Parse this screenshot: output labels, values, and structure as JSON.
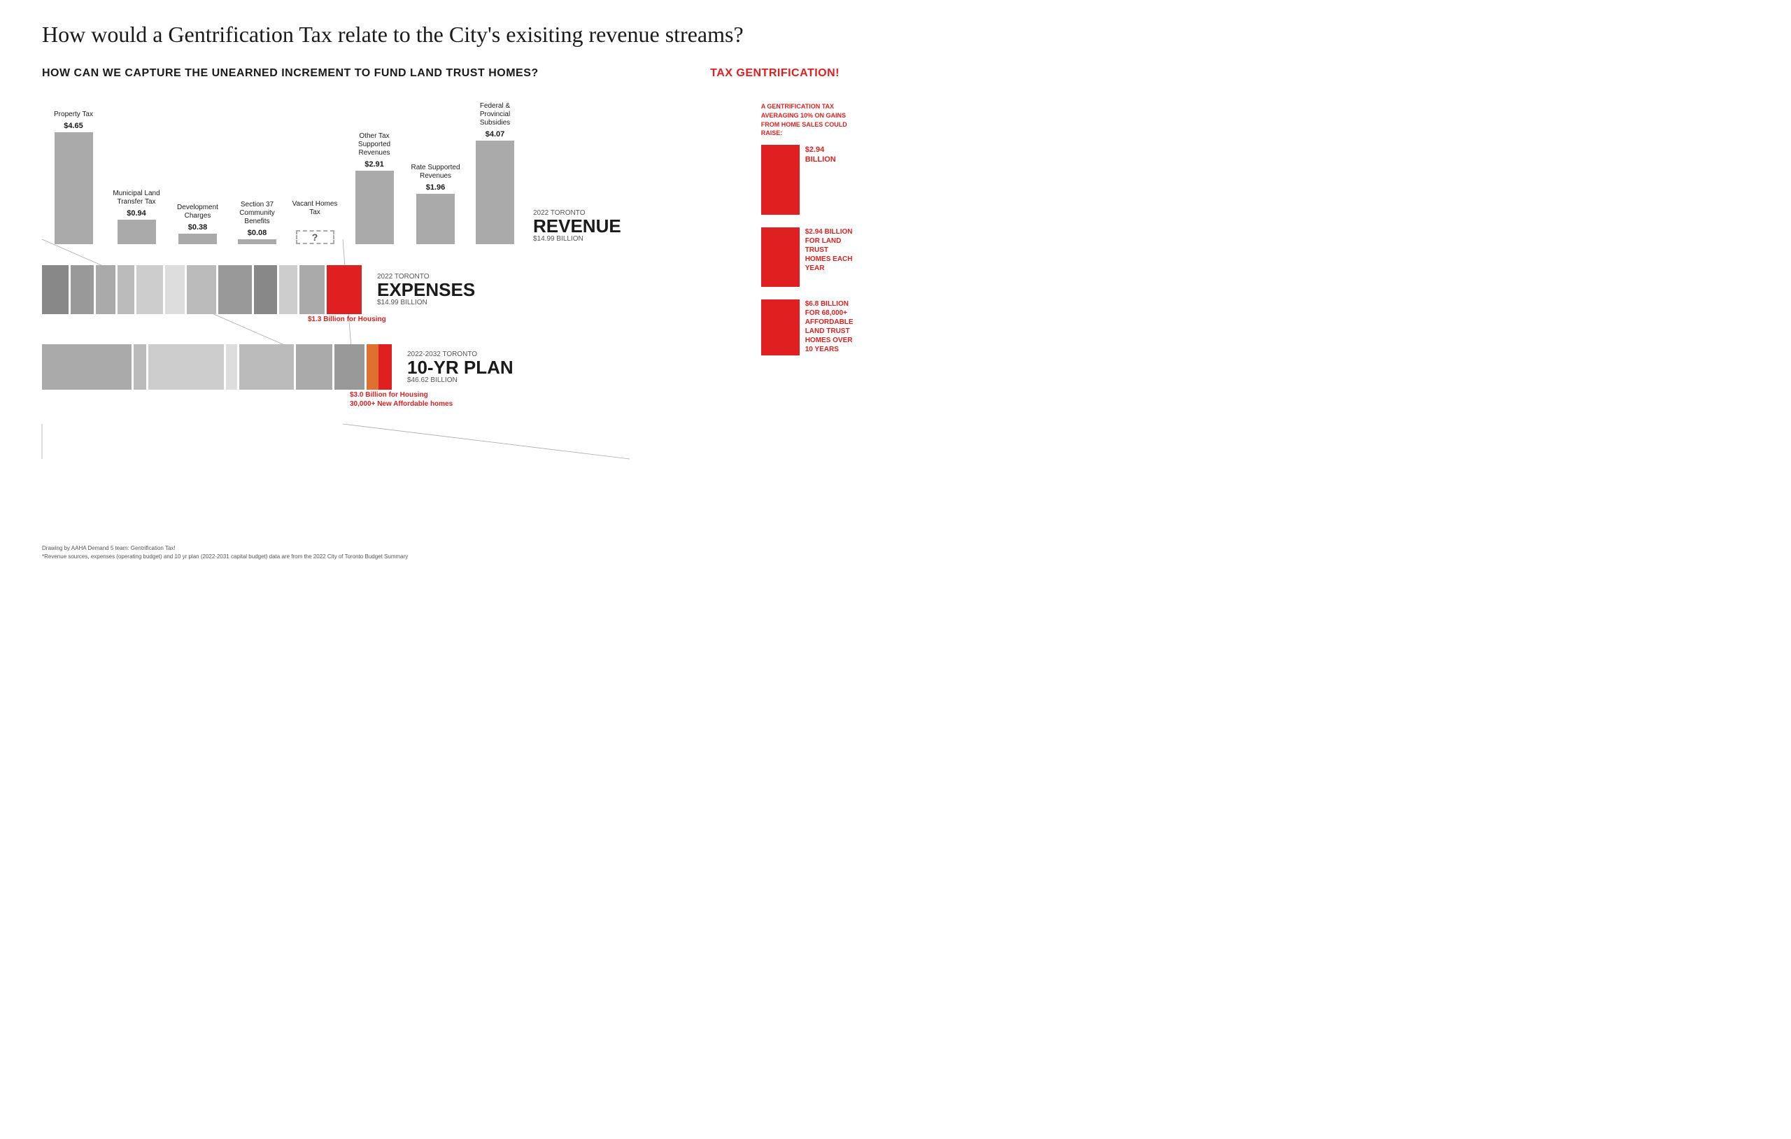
{
  "page": {
    "main_title": "How would a Gentrification Tax relate to the City's exisiting revenue streams?",
    "subtitle": "HOW CAN WE CAPTURE THE UNEARNED INCREMENT TO FUND LAND TRUST HOMES?",
    "tax_title": "TAX GENTRIFICATION!",
    "tax_desc": "A GENTRIFICATION TAX AVERAGING 10% ON GAINS FROM HOME SALES COULD RAISE:"
  },
  "revenue_bars": [
    {
      "label": "Property Tax",
      "value": "$4.65",
      "height": 160,
      "dashed": false
    },
    {
      "label": "Municipal Land Transfer Tax",
      "value": "$0.94",
      "height": 35,
      "dashed": false
    },
    {
      "label": "Development Charges",
      "value": "$0.38",
      "height": 15,
      "dashed": false
    },
    {
      "label": "Section 37 Community Benefits",
      "value": "$0.08",
      "height": 7,
      "dashed": false
    },
    {
      "label": "Vacant Homes Tax",
      "value": "?",
      "height": 20,
      "dashed": true
    },
    {
      "label": "Other Tax Supported Revenues",
      "value": "$2.91",
      "height": 105,
      "dashed": false
    },
    {
      "label": "Rate Supported Revenues",
      "value": "$1.96",
      "height": 72,
      "dashed": false
    },
    {
      "label": "Federal & Provincial Subsidies",
      "value": "$4.07",
      "height": 148,
      "dashed": false
    }
  ],
  "revenue_2022": {
    "year_label": "2022 TORONTO",
    "title": "REVENUE",
    "amount": "$14.99 BILLION"
  },
  "expenses_2022": {
    "year_label": "2022 TORONTO",
    "title": "EXPENSES",
    "amount": "$14.99 BILLION",
    "housing_label": "$1.3 Billion for Housing",
    "segments": [
      {
        "color": "#888",
        "width": 40
      },
      {
        "color": "#999",
        "width": 35
      },
      {
        "color": "#aaa",
        "width": 30
      },
      {
        "color": "#bbb",
        "width": 25
      },
      {
        "color": "#ccc",
        "width": 40
      },
      {
        "color": "#ddd",
        "width": 30
      },
      {
        "color": "#bbb",
        "width": 45
      },
      {
        "color": "#999",
        "width": 50
      },
      {
        "color": "#888",
        "width": 35
      },
      {
        "color": "#ccc",
        "width": 28
      },
      {
        "color": "#aaa",
        "width": 38
      },
      {
        "color": "#e02020",
        "width": 52
      }
    ]
  },
  "tenyr_plan": {
    "year_label": "2022-2032 TORONTO",
    "title": "10-YR PLAN",
    "amount": "$46.62 BILLION",
    "housing_label": "$3.0 Billion for Housing",
    "affordable_label": "30,000+ New Affordable homes",
    "segments": [
      {
        "color": "#aaa",
        "width": 130
      },
      {
        "color": "#bbb",
        "width": 20
      },
      {
        "color": "#ccc",
        "width": 110
      },
      {
        "color": "#ddd",
        "width": 18
      },
      {
        "color": "#bbb",
        "width": 80
      },
      {
        "color": "#aaa",
        "width": 55
      },
      {
        "color": "#999",
        "width": 45
      },
      {
        "color": "#e07030",
        "width": 18
      },
      {
        "color": "#e02020",
        "width": 20
      }
    ]
  },
  "right_panel": {
    "items": [
      {
        "value": "$2.94 BILLION",
        "height": 100,
        "label": ""
      },
      {
        "value": "$2.94 BILLION FOR LAND TRUST HOMES EACH YEAR",
        "height": 85,
        "label": ""
      },
      {
        "value": "$6.8 BILLION FOR 68,000+ AFFORDABLE LAND TRUST HOMES OVER 10 YEARS",
        "height": 80,
        "label": ""
      }
    ]
  },
  "footer": {
    "line1": "Drawing by AAHA Demand 5 team: Gentrification Tax!",
    "line2": "*Revenue sources, expenses (operating budget) and 10 yr plan (2022-2031 capital budget) data are from the 2022 City of Toronto Budget Summary"
  }
}
